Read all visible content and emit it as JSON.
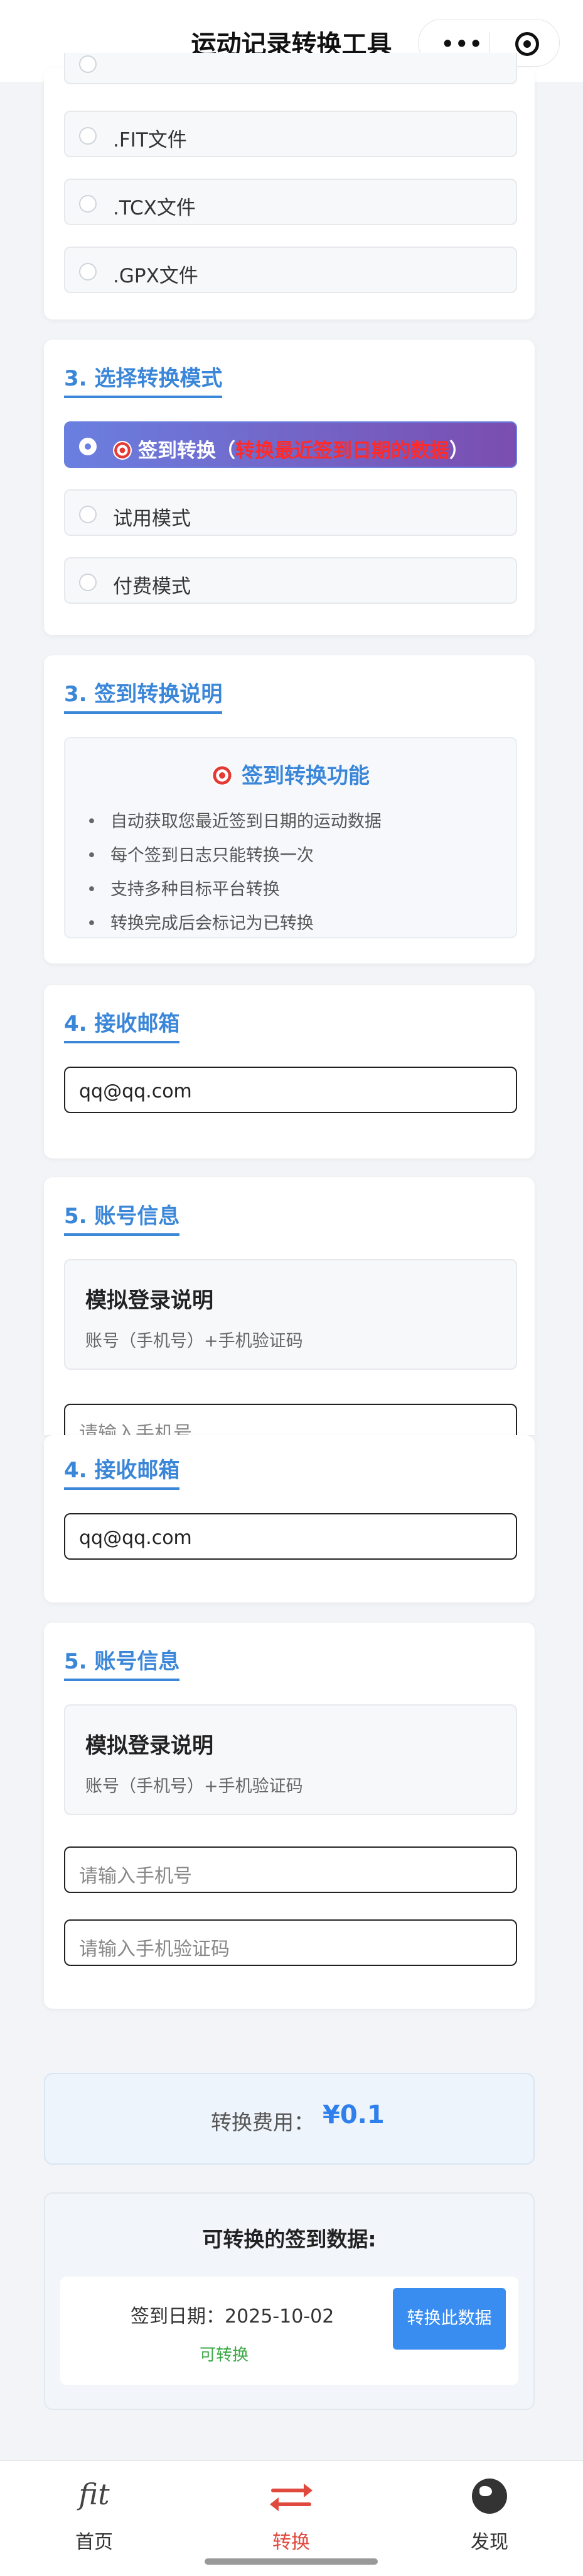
{
  "header": {
    "title": "运动记录转换工具",
    "more_label": "•••"
  },
  "format_options": [
    {
      "label": ".FIT文件"
    },
    {
      "label": ".TCX文件"
    },
    {
      "label": ".GPX文件"
    }
  ],
  "mode_section": {
    "title": "3. 选择转换模式",
    "options": [
      {
        "label_prefix": "签到转换（",
        "highlight": "转换最近签到日期的数据",
        "label_suffix": "）",
        "selected": true
      },
      {
        "label": "试用模式",
        "selected": false
      },
      {
        "label": "付费模式",
        "selected": false
      }
    ]
  },
  "sign_section": {
    "title": "3. 签到转换说明",
    "box_title": "签到转换功能",
    "items": [
      "自动获取您最近签到日期的运动数据",
      "每个签到日志只能转换一次",
      "支持多种目标平台转换",
      "转换完成后会标记为已转换"
    ]
  },
  "email_section": {
    "title": "4. 接收邮箱",
    "value": "qq@qq.com"
  },
  "account_section": {
    "title": "5. 账号信息",
    "login_title": "模拟登录说明",
    "login_desc": "账号（手机号）+手机验证码",
    "phone_placeholder": "请输入手机号",
    "code_placeholder": "请输入手机验证码"
  },
  "fee": {
    "label": "转换费用：",
    "value": "¥0.1"
  },
  "sign_data": {
    "title": "可转换的签到数据:",
    "date_label": "签到日期：",
    "date": "2025-10-02",
    "status": "可转换",
    "button": "转换此数据"
  },
  "tabbar": {
    "home": {
      "icon_text": "fit",
      "label": "首页"
    },
    "convert": {
      "label": "转换"
    },
    "discover": {
      "label": "发现"
    }
  }
}
